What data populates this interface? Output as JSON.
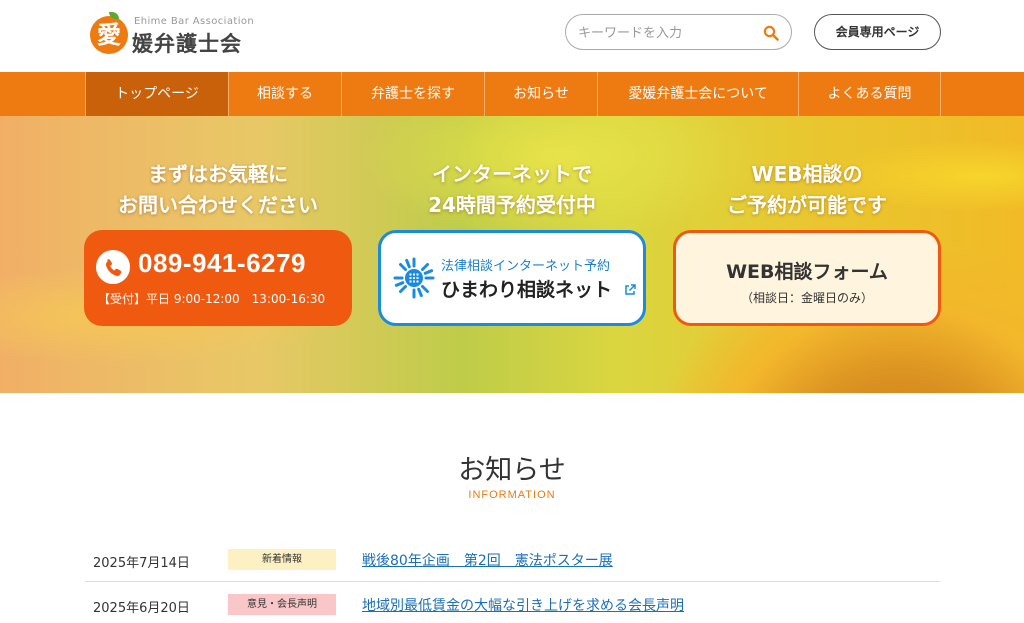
{
  "header": {
    "logo_en": "Ehime Bar Association",
    "logo_ja": "媛弁護士会",
    "logo_mark": "愛",
    "search_placeholder": "キーワードを入力",
    "member_button": "会員専用ページ"
  },
  "nav": {
    "items": [
      {
        "label": "トップページ",
        "active": true
      },
      {
        "label": "相談する"
      },
      {
        "label": "弁護士を探す"
      },
      {
        "label": "お知らせ"
      },
      {
        "label": "愛媛弁護士会について"
      },
      {
        "label": "よくある質問"
      }
    ]
  },
  "hero": {
    "col1_line1": "まずはお気軽に",
    "col1_line2": "お問い合わせください",
    "col2_line1": "インターネットで",
    "col2_line2": "24時間予約受付中",
    "col3_line1": "WEB相談の",
    "col3_line2": "ご予約が可能です",
    "phone_number": "089-941-6279",
    "phone_hours": "【受付】平日 9:00-12:00　13:00-16:30",
    "net_sub": "法律相談インターネット予約",
    "net_main": "ひまわり相談ネット",
    "web_main": "WEB相談フォーム",
    "web_sub": "（相談日：金曜日のみ）"
  },
  "info": {
    "title": "お知らせ",
    "subtitle": "INFORMATION",
    "news": [
      {
        "date": "2025年7月14日",
        "badge": "新着情報",
        "title": "戦後80年企画　第2回　憲法ポスター展"
      },
      {
        "date": "2025年6月20日",
        "badge": "意見・会長声明",
        "title": "地域別最低賃金の大幅な引き上げを求める会長声明"
      }
    ]
  },
  "colors": {
    "brand_orange": "#ee7a12",
    "phone_card": "#f05a10",
    "net_border": "#1a8be0",
    "link": "#1a6fb8"
  }
}
